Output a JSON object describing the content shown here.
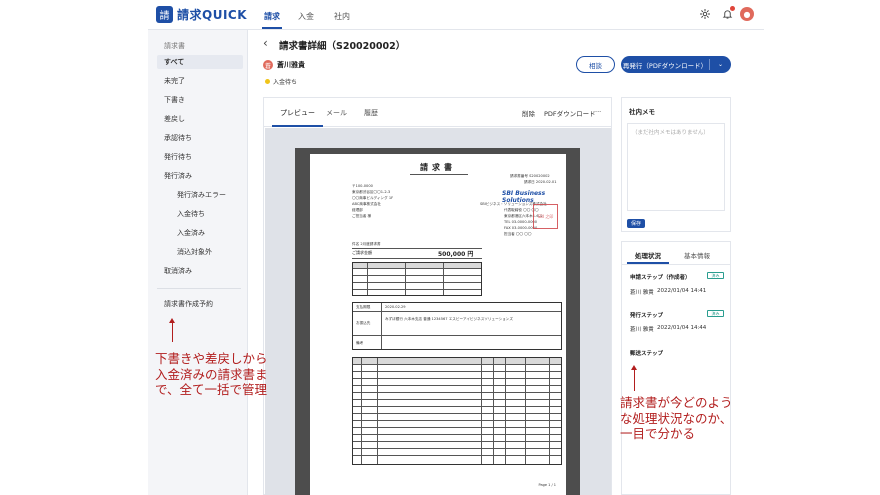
{
  "app": {
    "logo_glyph": "請",
    "logo_text": "請求QUICK"
  },
  "nav": {
    "tabs": [
      "請求",
      "入金",
      "社内"
    ],
    "active": 0,
    "icons": [
      "gear-icon",
      "bell-icon",
      "user-avatar"
    ],
    "avatar_glyph": "●"
  },
  "sidebar": {
    "heading": "請求書",
    "items": [
      "すべて",
      "未完了",
      "下書き",
      "差戻し",
      "承認待ち",
      "発行待ち",
      "発行済み",
      "発行済みエラー",
      "入金待ち",
      "入金済み",
      "消込対象外",
      "取消済み"
    ],
    "footer_item": "請求書作成予約"
  },
  "main": {
    "back_icon": "‹",
    "title": "請求書詳細（S20020002）",
    "user_avatar": "蒼",
    "user_name": "蒼川雅貴",
    "status": "入金待ち",
    "status_color": "#f0c419",
    "btn_outline": "相談",
    "btn_primary": "再発行（PDFダウンロード）",
    "btn_dropdown": "⌄"
  },
  "preview": {
    "tabs": [
      "プレビュー",
      "メール",
      "履歴"
    ],
    "actions": [
      "削除",
      "PDFダウンロード",
      "···"
    ]
  },
  "document": {
    "title": "請求書",
    "meta_right": [
      "請求書番号 S20020002",
      "請求日 2020.02.01"
    ],
    "to_lines": [
      "〒100-0000",
      "東京都渋谷区〇〇1-2-3",
      "〇〇商事ビルディング 1F",
      "ABC商事株式会社",
      "経理部",
      "ご担当者 様"
    ],
    "company_logo": "SBI Business Solutions",
    "company_lines": [
      "SBIビジネス・ソリューションズ株式会社",
      "代表取締役 〇〇 〇〇",
      "東京都港区六本木1-6-1",
      "TEL 03-0000-0000",
      "FAX 03-0000-0000",
      "担当者 〇〇 〇〇"
    ],
    "stamp_text": "SBI 之印",
    "subject_label": "件名  2月度請求書",
    "amount_label": "ご請求金額",
    "amount_value": "500,000 円",
    "bank_label": "お振込先",
    "bank_text": "みずほ銀行 六本木支店 普通 1234567 エスビーアイビジネスソリューションズ",
    "note_label": "備考",
    "deadline_label": "支払期限",
    "deadline_value": "2020.02.29",
    "footer": "Page 1 / 1"
  },
  "memo": {
    "title": "社内メモ",
    "placeholder": "（まだ社内メモはありません）",
    "save": "保存"
  },
  "status_panel": {
    "tabs": [
      "処理状況",
      "基本情報"
    ],
    "steps": [
      {
        "title": "申請ステップ（作成者）",
        "badge": "済み",
        "who": "蒼川 雅貴",
        "date": "2022/01/04 14:41"
      },
      {
        "title": "発行ステップ",
        "badge": "済み",
        "who": "蒼川 雅貴",
        "date": "2022/01/04 14:44"
      },
      {
        "title": "郵送ステップ",
        "badge": "",
        "who": "",
        "date": ""
      }
    ]
  },
  "annotations": {
    "left": [
      "下書きや差戻しから",
      "入金済みの請求書ま",
      "で、全て一括で管理"
    ],
    "right": [
      "請求書が今どのよう",
      "な処理状況なのか、",
      "一目で分かる"
    ],
    "color": "#b21e1e"
  }
}
